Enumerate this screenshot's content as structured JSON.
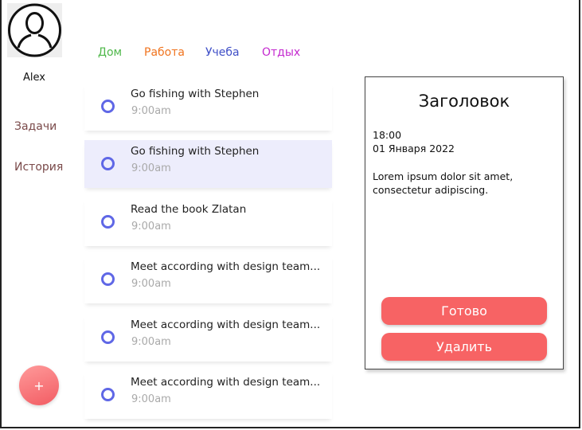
{
  "user": {
    "name": "Alex"
  },
  "sidebar": {
    "items": [
      {
        "label": "Задачи"
      },
      {
        "label": "История"
      }
    ],
    "add_label": "+"
  },
  "tabs": [
    {
      "label": "Дом",
      "color": "#4fb84a"
    },
    {
      "label": "Работа",
      "color": "#f0741f"
    },
    {
      "label": "Учеба",
      "color": "#3f4fc7"
    },
    {
      "label": "Отдых",
      "color": "#c429cf"
    }
  ],
  "tasks": [
    {
      "title": "Go fishing with Stephen",
      "time": "9:00am",
      "selected": false
    },
    {
      "title": "Go fishing with Stephen",
      "time": "9:00am",
      "selected": true
    },
    {
      "title": "Read the book Zlatan",
      "time": "9:00am",
      "selected": false
    },
    {
      "title": "Meet according with design team...",
      "time": "9:00am",
      "selected": false
    },
    {
      "title": "Meet according with design team...",
      "time": "9:00am",
      "selected": false
    },
    {
      "title": "Meet according with design team...",
      "time": "9:00am",
      "selected": false
    }
  ],
  "detail": {
    "title": "Заголовок",
    "time": "18:00",
    "date": "01 Января 2022",
    "description": "Lorem ipsum dolor sit amet, consectetur adipiscing.",
    "done_label": "Готово",
    "delete_label": "Удалить"
  },
  "colors": {
    "accent": "#5f67e6",
    "selected_bg": "#ededfc",
    "button": "#f76364",
    "sidebar_text": "#7a4a4a"
  }
}
